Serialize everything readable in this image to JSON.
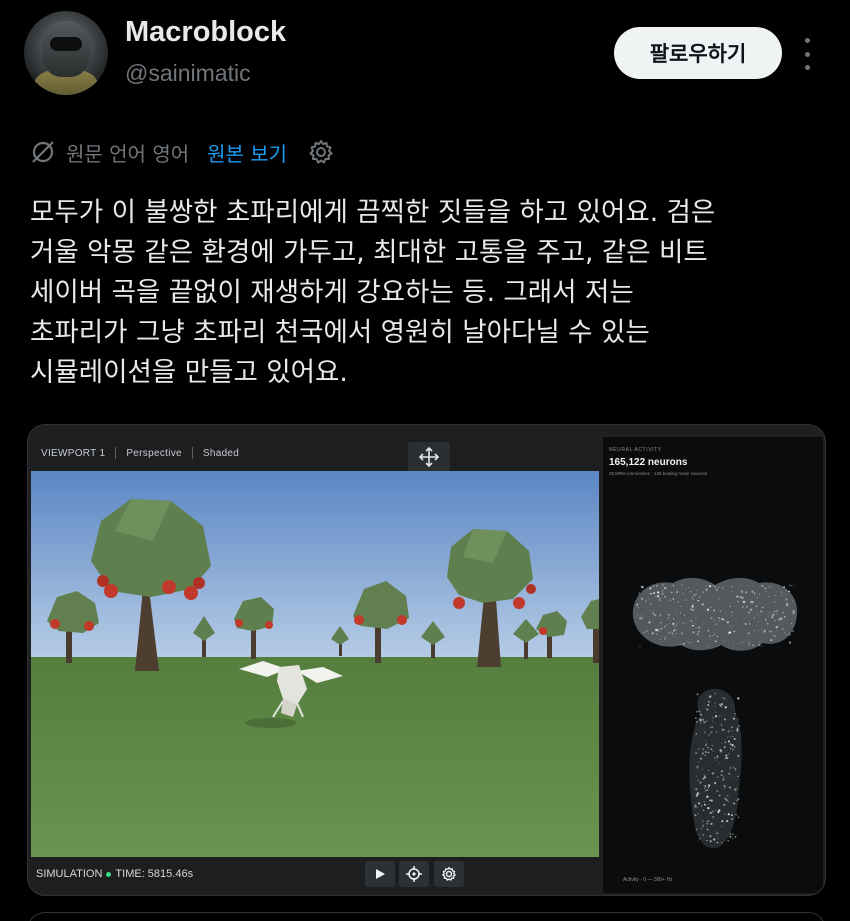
{
  "header": {
    "display_name": "Macroblock",
    "handle": "@sainimatic",
    "follow_label": "팔로우하기"
  },
  "translation": {
    "label": "원문 언어 영어",
    "show_original": "원본 보기"
  },
  "tweet": {
    "text": "모두가 이 불쌍한 초파리에게 끔찍한 짓들을 하고 있어요. 검은\n거울 악몽 같은 환경에 가두고, 최대한 고통을 주고, 같은 비트\n세이버 곡을 끝없이 재생하게 강요하는 등. 그래서 저는\n초파리가 그냥 초파리 천국에서 영원히 날아다닐 수 있는\n시뮬레이션을 만들고 있어요."
  },
  "media": {
    "viewport": {
      "name": "VIEWPORT 1",
      "projection": "Perspective",
      "shading": "Shaded"
    },
    "simulation": {
      "label": "SIMULATION",
      "time_label": "TIME: 5815.46s"
    },
    "neural": {
      "title": "NEURAL ACTIVITY",
      "count": "165,122 neurons",
      "subtitle": "25.5RM connections · 136 bowing motor neurons",
      "activity": "Activity · 0 — 300+ Hz"
    },
    "colors": {
      "sky_top": "#5b86c4",
      "sky_bottom": "#b7cde6",
      "grass": "#5f8a45",
      "tree": "#5f7f4e",
      "trunk": "#4a3b2e",
      "apple": "#c0392b"
    }
  },
  "icons": [
    "avatar",
    "more-icon",
    "translate-icon",
    "gear-icon",
    "move-icon",
    "play-icon",
    "target-icon",
    "settings-icon"
  ]
}
